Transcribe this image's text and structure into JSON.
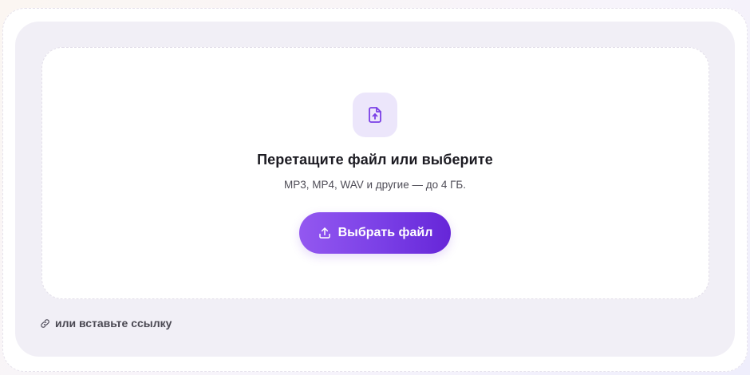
{
  "dropzone": {
    "icon": "file-upload-icon",
    "title": "Перетащите файл или выберите",
    "subtitle": "MP3, MP4, WAV и другие — до 4 ГБ.",
    "button_icon": "upload-icon",
    "button_label": "Выбрать файл"
  },
  "link_paste": {
    "icon": "link-icon",
    "label": "или вставьте ссылку"
  },
  "colors": {
    "accent": "#7a3fe6",
    "accent_light": "#ece6fb",
    "panel_bg": "#f1eff6"
  }
}
